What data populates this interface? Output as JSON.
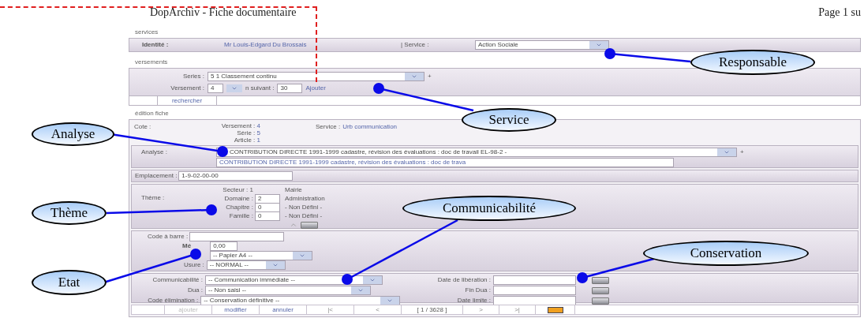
{
  "header": {
    "title": "DopArchiv - Fiche documentaire",
    "page": "Page 1 su"
  },
  "services": {
    "heading": "services",
    "identity_label": "Identité :",
    "identity_value": "Mr Louis-Edgard Du Brossais",
    "service_label": "| Service :",
    "service_value": "Action Sociale"
  },
  "versements": {
    "heading": "versements",
    "series_label": "Series :",
    "series_value": "5   1 Classement continu",
    "plus": "+",
    "versement_label": "Versement :",
    "versement_value": "4",
    "next_label": "n suivant :",
    "next_value": "30",
    "add_link": "Ajouter",
    "search_tab": "rechercher"
  },
  "fiche": {
    "heading": "édition fiche",
    "cote_label": "Cote :",
    "cote": [
      {
        "label": "Versement :",
        "value": "4"
      },
      {
        "label": "Série :",
        "value": "5"
      },
      {
        "label": "Article :",
        "value": "1"
      }
    ],
    "service_label": "Service :",
    "service_value": "Urb communication",
    "analyse_label": "Analyse :",
    "analyse_value": "CONTRIBUTION DIRECTE 1991-1999 cadastre, révision des évaluations : doc de travail EL-98-2 -",
    "analyse_plus": "+",
    "analyse_line2": "CONTRIBUTION DIRECTE 1991-1999 cadastre, révision des évaluations : doc de trava",
    "emplacement_label": "Emplacement :",
    "emplacement_value": "1-9-02-00-00",
    "theme_label": "Thème :",
    "theme_rows": [
      {
        "kind": "static",
        "label": "Secteur : 1",
        "name": "Mairie"
      },
      {
        "kind": "field",
        "label": "Domaine :",
        "value": "2",
        "name": "Administration"
      },
      {
        "kind": "field",
        "label": "Chapitre :",
        "value": "0",
        "name": "- Non Défini -"
      },
      {
        "kind": "field",
        "label": "Famille :",
        "value": "0",
        "name": "- Non Défini -"
      }
    ],
    "barcode_label": "Code à barre :",
    "metrage_label": "Mé",
    "metrage_value": "0,00",
    "support_value": "-- Papier A4 --",
    "usure_label": "Usure :",
    "usure_value": "-- NORMAL --",
    "conservation_left": [
      {
        "label": "Communicabilité :",
        "value": "-- Communication immédiate --"
      },
      {
        "label": "Dua :",
        "value": "-- Non saisi --"
      },
      {
        "label": "Code élimination :",
        "value": "-- Conservation définitive --"
      }
    ],
    "conservation_right": [
      {
        "label": "Date de libération :"
      },
      {
        "label": "Fin Dua :"
      },
      {
        "label": "Date limite :"
      }
    ]
  },
  "footer": {
    "buttons": [
      {
        "label": "ajouter",
        "disabled": true
      },
      {
        "label": "modifier",
        "disabled": false
      },
      {
        "label": "annuler",
        "disabled": false
      }
    ],
    "nav_back": [
      "|<",
      "<"
    ],
    "counter": "[ 1 / 3628 ]",
    "nav_forward": [
      ">",
      ">|"
    ]
  },
  "callouts": [
    {
      "label": "Responsable"
    },
    {
      "label": "Service"
    },
    {
      "label": "Analyse"
    },
    {
      "label": "Thème"
    },
    {
      "label": "Communicabilité"
    },
    {
      "label": "Conservation"
    },
    {
      "label": "Etat"
    }
  ]
}
